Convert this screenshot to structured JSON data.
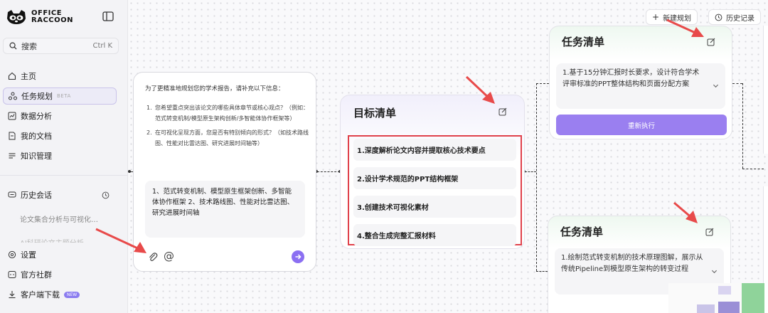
{
  "brand": {
    "line1": "OFFICE",
    "line2": "RACCOON"
  },
  "search": {
    "label": "搜索",
    "shortcut": "Ctrl K"
  },
  "nav": {
    "home": "主页",
    "task_planning": "任务规划",
    "task_planning_badge": "BETA",
    "data_analysis": "数据分析",
    "my_docs": "我的文档",
    "knowledge": "知识管理"
  },
  "history": {
    "title": "历史会话",
    "items": [
      "论文集合分析与可视化…",
      "AI科研论文主题分析"
    ]
  },
  "bottom_nav": {
    "settings": "设置",
    "community": "官方社群",
    "download": "客户端下载",
    "download_badge": "NEW"
  },
  "toolbar": {
    "new_plan": "新建规划",
    "history": "历史记录"
  },
  "chat": {
    "intro": "为了更精准地规划您的学术报告，请补充以下信息：",
    "questions": [
      {
        "num": "1.",
        "text": "您希望重点突出该论文的哪些具体章节或核心观点？（例如：范式转变机制/模型原生架构创新/多智能体协作框架等）"
      },
      {
        "num": "2.",
        "text": "在可视化呈现方面，您是否有特别倾向的形式？（如技术路线图、性能对比雷达图、研究进展时间轴等）"
      }
    ],
    "answer": "1、范式转变机制、模型原生框架创新、多智能体协作框架 2、技术路线图、性能对比雷达图、研究进展时间轴"
  },
  "goal": {
    "title": "目标清单",
    "items": [
      "1.深度解析论文内容并提取核心技术要点",
      "2.设计学术规范的PPT结构框架",
      "3.创建技术可视化素材",
      "4.整合生成完整汇报材料"
    ]
  },
  "tasks": [
    {
      "title": "任务清单",
      "body": "1.基于15分钟汇报时长要求，设计符合学术评审标准的PPT整体结构和页面分配方案",
      "action": "重新执行"
    },
    {
      "title": "任务清单",
      "body": "1.绘制范式转变机制的技术原理图解，展示从传统Pipeline到模型原生架构的转变过程"
    }
  ],
  "colors": {
    "accent": "#8b6ff2",
    "highlight_border": "#e0414b",
    "arrow": "#e84a4a"
  }
}
